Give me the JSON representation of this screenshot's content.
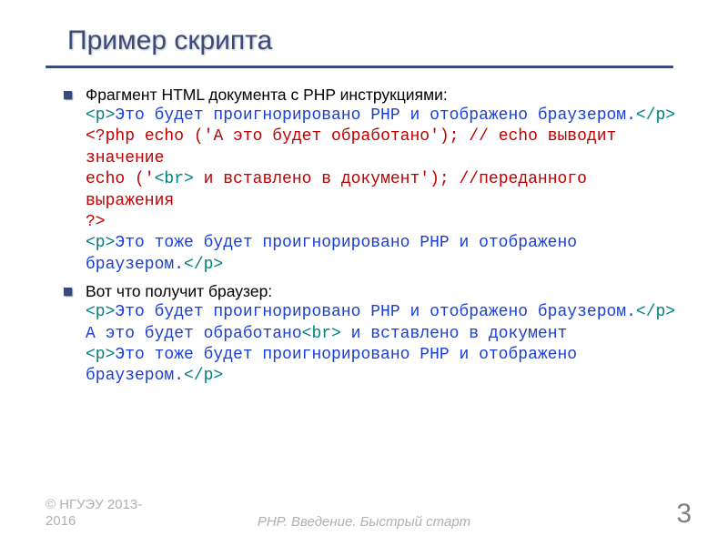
{
  "title": "Пример скрипта",
  "bullet1_intro": "Фрагмент HTML документа с PHP инструкциями:",
  "code1": {
    "l1a": "<p>",
    "l1b": "Это будет проигнорировано PHP и отображено браузером.",
    "l1c": "</p>",
    "l2a": "<?php",
    "l2b": " echo ('",
    "l2c": "А это будет обработано",
    "l2d": "'); // echo выводит значение",
    "l3a": "   echo ('",
    "l3b": "<br>",
    "l3c": " и вставлено в документ",
    "l3d": "'); //переданного выражения",
    "l4": " ?>",
    "l5a": "<p>",
    "l5b": "Это тоже будет проигнорировано PHP и отображено браузером.",
    "l5c": "</p>"
  },
  "bullet2_intro": "Вот что получит браузер:",
  "code2": {
    "l1a": "<p>",
    "l1b": "Это будет проигнорировано PHP и отображено браузером.",
    "l1c": "</p>",
    "l2a": "А это будет обработано",
    "l2b": "<br>",
    "l2c": " и вставлено в документ",
    "l3a": "<p>",
    "l3b": "Это тоже будет проигнорировано PHP и отображено браузером.",
    "l3c": "</p>"
  },
  "footer_left_1": "© НГУЭУ 2013-",
  "footer_left_2": "2016",
  "footer_center": "PHP. Введение. Быстрый старт",
  "page_number": "3"
}
